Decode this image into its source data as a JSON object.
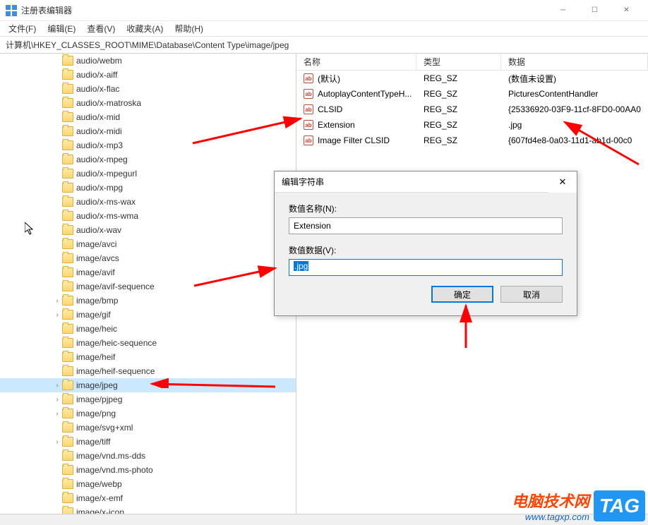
{
  "window": {
    "title": "注册表编辑器"
  },
  "menu": {
    "file": "文件(F)",
    "edit": "编辑(E)",
    "view": "查看(V)",
    "favorites": "收藏夹(A)",
    "help": "帮助(H)"
  },
  "addressbar": "计算机\\HKEY_CLASSES_ROOT\\MIME\\Database\\Content Type\\image/jpeg",
  "tree": {
    "items": [
      {
        "label": "audio/webm",
        "expand": false
      },
      {
        "label": "audio/x-aiff",
        "expand": false
      },
      {
        "label": "audio/x-flac",
        "expand": false
      },
      {
        "label": "audio/x-matroska",
        "expand": false
      },
      {
        "label": "audio/x-mid",
        "expand": false
      },
      {
        "label": "audio/x-midi",
        "expand": false
      },
      {
        "label": "audio/x-mp3",
        "expand": false
      },
      {
        "label": "audio/x-mpeg",
        "expand": false
      },
      {
        "label": "audio/x-mpegurl",
        "expand": false
      },
      {
        "label": "audio/x-mpg",
        "expand": false
      },
      {
        "label": "audio/x-ms-wax",
        "expand": false
      },
      {
        "label": "audio/x-ms-wma",
        "expand": false
      },
      {
        "label": "audio/x-wav",
        "expand": false
      },
      {
        "label": "image/avci",
        "expand": false
      },
      {
        "label": "image/avcs",
        "expand": false
      },
      {
        "label": "image/avif",
        "expand": false
      },
      {
        "label": "image/avif-sequence",
        "expand": false
      },
      {
        "label": "image/bmp",
        "expand": true
      },
      {
        "label": "image/gif",
        "expand": true
      },
      {
        "label": "image/heic",
        "expand": false
      },
      {
        "label": "image/heic-sequence",
        "expand": false
      },
      {
        "label": "image/heif",
        "expand": false
      },
      {
        "label": "image/heif-sequence",
        "expand": false
      },
      {
        "label": "image/jpeg",
        "expand": true,
        "selected": true
      },
      {
        "label": "image/pjpeg",
        "expand": true
      },
      {
        "label": "image/png",
        "expand": true
      },
      {
        "label": "image/svg+xml",
        "expand": false
      },
      {
        "label": "image/tiff",
        "expand": true
      },
      {
        "label": "image/vnd.ms-dds",
        "expand": false
      },
      {
        "label": "image/vnd.ms-photo",
        "expand": false
      },
      {
        "label": "image/webp",
        "expand": false
      },
      {
        "label": "image/x-emf",
        "expand": false
      },
      {
        "label": "image/x-icon",
        "expand": false
      }
    ]
  },
  "list": {
    "headers": {
      "name": "名称",
      "type": "类型",
      "data": "数据"
    },
    "rows": [
      {
        "name": "(默认)",
        "type": "REG_SZ",
        "data": "(数值未设置)"
      },
      {
        "name": "AutoplayContentTypeH...",
        "type": "REG_SZ",
        "data": "PicturesContentHandler"
      },
      {
        "name": "CLSID",
        "type": "REG_SZ",
        "data": "{25336920-03F9-11cf-8FD0-00AA0"
      },
      {
        "name": "Extension",
        "type": "REG_SZ",
        "data": ".jpg"
      },
      {
        "name": "Image Filter CLSID",
        "type": "REG_SZ",
        "data": "{607fd4e8-0a03-11d1-ab1d-00c0"
      }
    ]
  },
  "dialog": {
    "title": "编辑字符串",
    "nameLabel": "数值名称(N):",
    "nameValue": "Extension",
    "dataLabel": "数值数据(V):",
    "dataValue": ".jpg",
    "ok": "确定",
    "cancel": "取消"
  },
  "watermark": {
    "line1": "电脑技术网",
    "line2": "www.tagxp.com",
    "badge": "TAG"
  }
}
